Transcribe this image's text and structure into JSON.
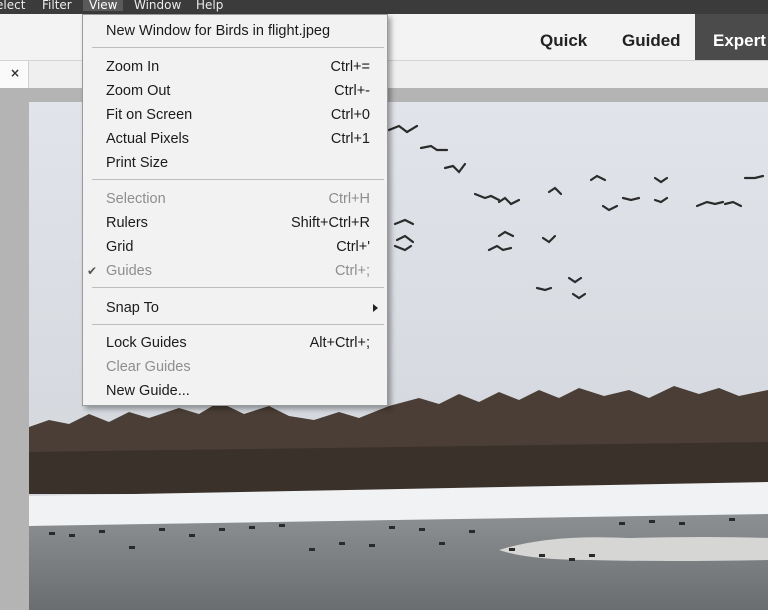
{
  "menubar": {
    "items": [
      "elect",
      "Filter",
      "View",
      "Window",
      "Help"
    ],
    "active": "View"
  },
  "modes": {
    "quick": "Quick",
    "guided": "Guided",
    "expert": "Expert"
  },
  "doc_tab": {
    "stub": ")",
    "close": "×"
  },
  "view_menu": {
    "new_window": "New Window for Birds in flight.jpeg",
    "zoom_in": {
      "label": "Zoom In",
      "shortcut": "Ctrl+="
    },
    "zoom_out": {
      "label": "Zoom Out",
      "shortcut": "Ctrl+-"
    },
    "fit_on_screen": {
      "label": "Fit on Screen",
      "shortcut": "Ctrl+0"
    },
    "actual_pixels": {
      "label": "Actual Pixels",
      "shortcut": "Ctrl+1"
    },
    "print_size": {
      "label": "Print Size"
    },
    "selection": {
      "label": "Selection",
      "shortcut": "Ctrl+H",
      "enabled": false
    },
    "rulers": {
      "label": "Rulers",
      "shortcut": "Shift+Ctrl+R"
    },
    "grid": {
      "label": "Grid",
      "shortcut": "Ctrl+'"
    },
    "guides": {
      "label": "Guides",
      "shortcut": "Ctrl+;",
      "enabled": false,
      "checked": true
    },
    "snap_to": {
      "label": "Snap To"
    },
    "lock_guides": {
      "label": "Lock Guides",
      "shortcut": "Alt+Ctrl+;"
    },
    "clear_guides": {
      "label": "Clear Guides",
      "enabled": false
    },
    "new_guide": {
      "label": "New Guide..."
    }
  },
  "colors": {
    "menubar_bg": "#3b3b3b",
    "expert_bg": "#4b4b4b",
    "menu_bg": "#f2f2f2",
    "disabled_text": "#8e8e8e",
    "sky": "#d9dde3",
    "water": "#7a7d80"
  }
}
